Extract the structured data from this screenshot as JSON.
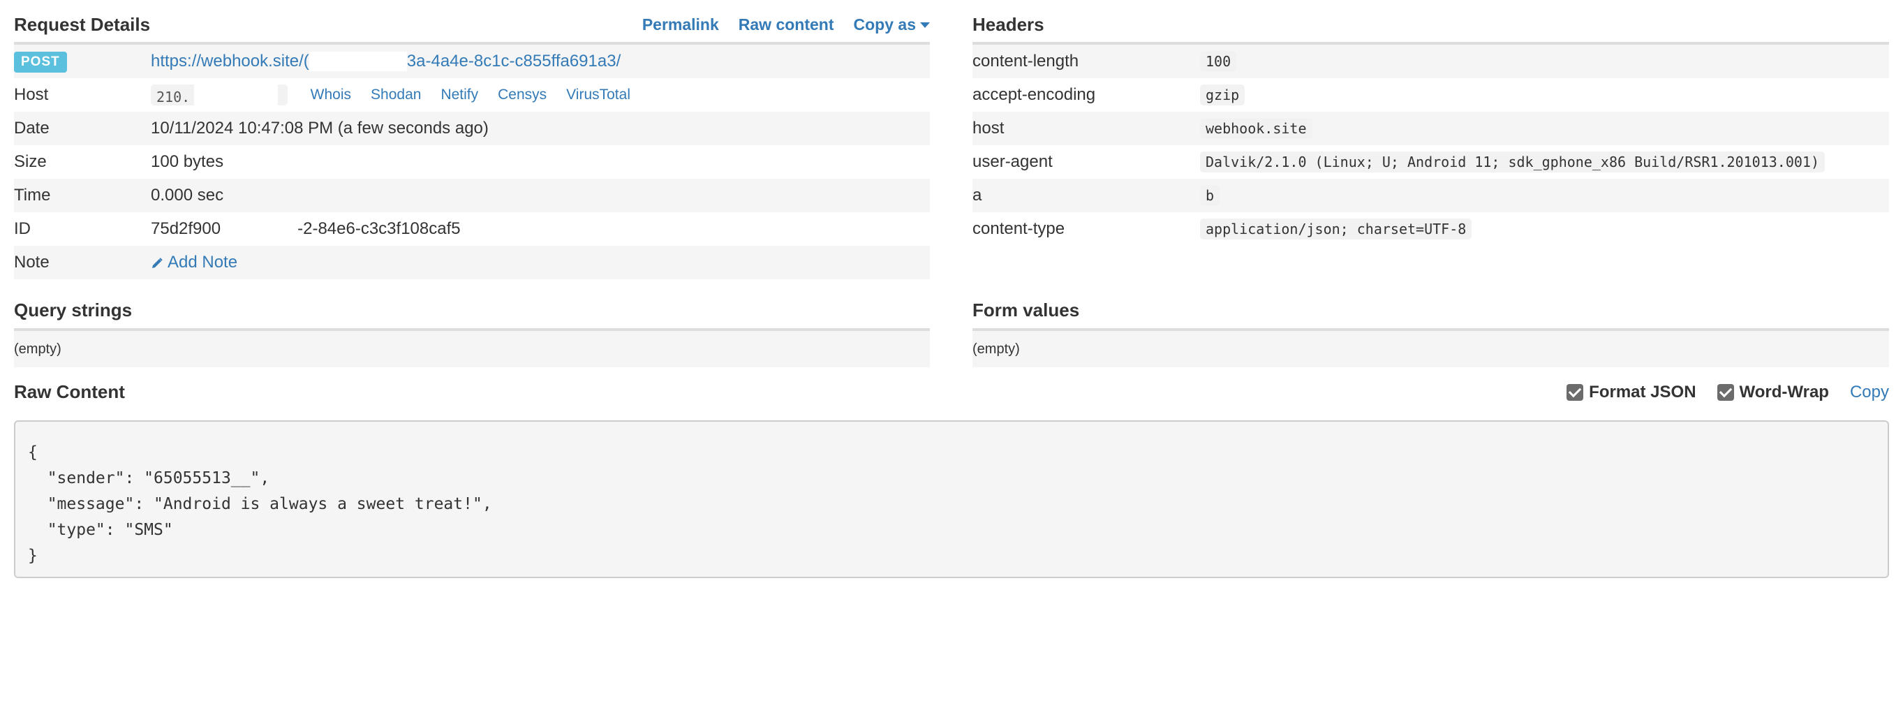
{
  "request_details": {
    "title": "Request Details",
    "links": {
      "permalink": "Permalink",
      "raw_content": "Raw content",
      "copy_as": "Copy as"
    },
    "method": "POST",
    "url": "https://webhook.site/0___________3a-4a4e-8c1c-c855ffa691a3/",
    "url_prefix": "https://webhook.site/(",
    "url_suffix": "3a-4a4e-8c1c-c855ffa691a3/",
    "host_label": "Host",
    "host_partial": "210.",
    "host_links": [
      "Whois",
      "Shodan",
      "Netify",
      "Censys",
      "VirusTotal"
    ],
    "date_label": "Date",
    "date_value": "10/11/2024 10:47:08 PM (a few seconds ago)",
    "size_label": "Size",
    "size_value": "100 bytes",
    "time_label": "Time",
    "time_value": "0.000 sec",
    "id_label": "ID",
    "id_prefix": "75d2f900",
    "id_suffix": "-2-84e6-c3c3f108caf5",
    "note_label": "Note",
    "note_action": "Add Note"
  },
  "headers": {
    "title": "Headers",
    "rows": [
      {
        "name": "content-length",
        "value": "100"
      },
      {
        "name": "accept-encoding",
        "value": "gzip"
      },
      {
        "name": "host",
        "value": "webhook.site"
      },
      {
        "name": "user-agent",
        "value": "Dalvik/2.1.0 (Linux; U; Android 11; sdk_gphone_x86 Build/RSR1.201013.001)"
      },
      {
        "name": "a",
        "value": "b"
      },
      {
        "name": "content-type",
        "value": "application/json; charset=UTF-8"
      }
    ]
  },
  "query_strings": {
    "title": "Query strings",
    "empty": "(empty)"
  },
  "form_values": {
    "title": "Form values",
    "empty": "(empty)"
  },
  "raw_content": {
    "title": "Raw Content",
    "format_json": "Format JSON",
    "word_wrap": "Word-Wrap",
    "copy": "Copy",
    "lines": [
      "{",
      "  \"sender\": \"65055513__\",",
      "  \"message\": \"Android is always a sweet treat!\",",
      "  \"type\": \"SMS\"",
      "}"
    ]
  },
  "colors": {
    "link": "#337ab7",
    "badge": "#5bc0de",
    "stripe": "#f5f5f5",
    "rule": "#dddddd"
  }
}
